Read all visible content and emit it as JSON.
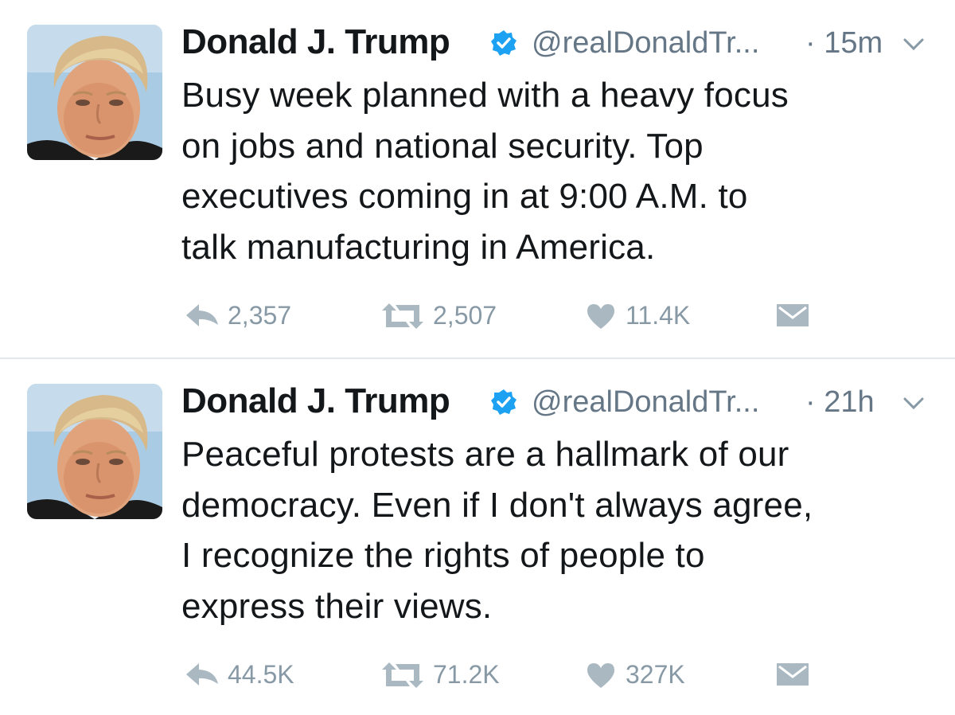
{
  "tweets": [
    {
      "name": "Donald J. Trump",
      "handle": "@realDonaldTr...",
      "time": "· 15m",
      "text": "Busy week planned with a heavy focus\non jobs and national security. Top\nexecutives coming in at 9:00 A.M. to\ntalk manufacturing in America.",
      "replies": "2,357",
      "retweets": "2,507",
      "likes": "11.4K"
    },
    {
      "name": "Donald J. Trump",
      "handle": "@realDonaldTr...",
      "time": "· 21h",
      "text": "Peaceful protests are a hallmark of our\ndemocracy. Even if I don't always agree,\nI recognize the rights of people to\nexpress their views.",
      "replies": "44.5K",
      "retweets": "71.2K",
      "likes": "327K"
    }
  ],
  "icons": {
    "verified": "verified-badge-icon",
    "caret": "chevron-down-icon",
    "reply": "reply-icon",
    "retweet": "retweet-icon",
    "like": "heart-icon",
    "dm": "envelope-icon"
  },
  "colors": {
    "text": "#14171a",
    "secondary": "#657786",
    "action": "#aab8c2",
    "verified": "#1da1f2",
    "divider": "#e1e8ed"
  }
}
